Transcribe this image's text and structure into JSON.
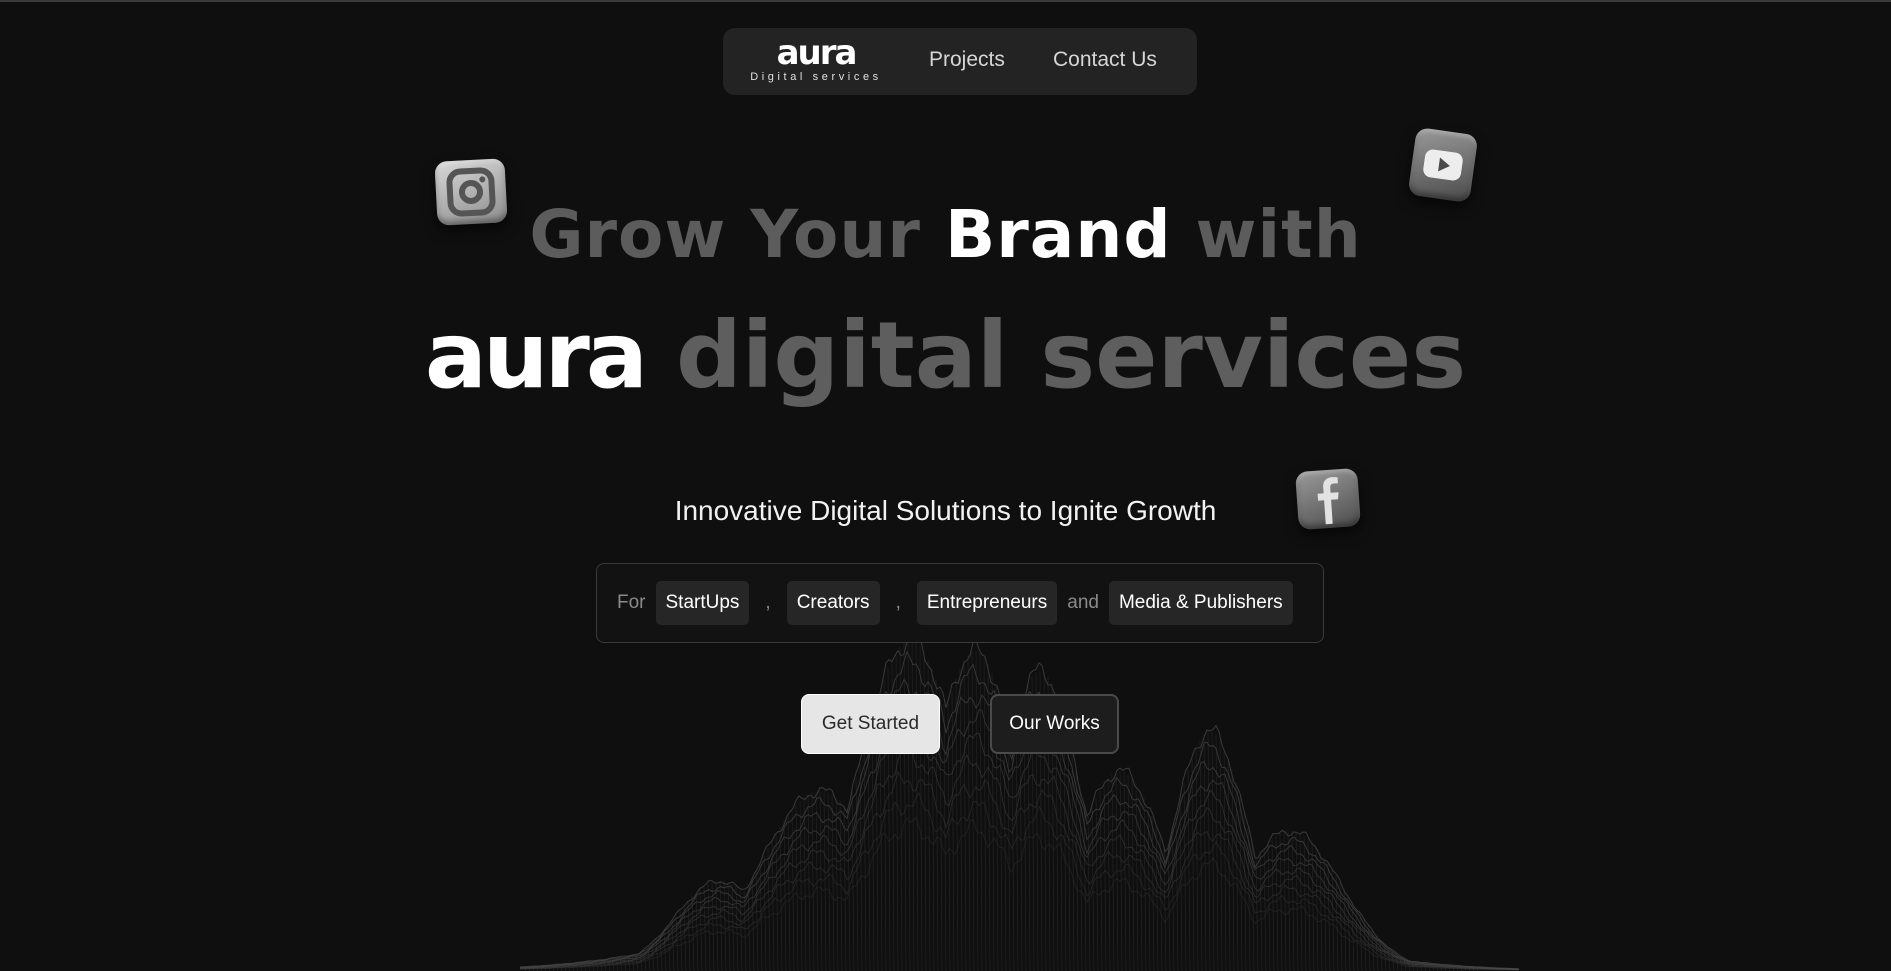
{
  "nav": {
    "brand_wordmark": "aura",
    "brand_tagline": "Digital services",
    "links": [
      {
        "label": "Projects"
      },
      {
        "label": "Contact Us"
      }
    ]
  },
  "hero": {
    "line1_prefix": "Grow Your",
    "line1_highlight": "Brand",
    "line1_suffix": "with",
    "line2_highlight": "aura",
    "line2_rest": "digital services",
    "subheadline": "Innovative Digital Solutions to Ignite Growth"
  },
  "audience": {
    "lead": "For",
    "chips": [
      "StartUps",
      "Creators",
      "Entrepreneurs",
      "Media & Publishers"
    ],
    "separator": ",",
    "conjunction": "and"
  },
  "actions": {
    "primary_label": "Get Started",
    "secondary_label": "Our Works"
  },
  "icons": {
    "floating": [
      "instagram-icon",
      "youtube-icon",
      "facebook-icon"
    ],
    "background": "wireframe-mountain-graphic"
  },
  "colors": {
    "background": "#0f0f0f",
    "nav_background": "#232323",
    "dim_text": "#5c5c5c",
    "chip_background": "#262626"
  }
}
